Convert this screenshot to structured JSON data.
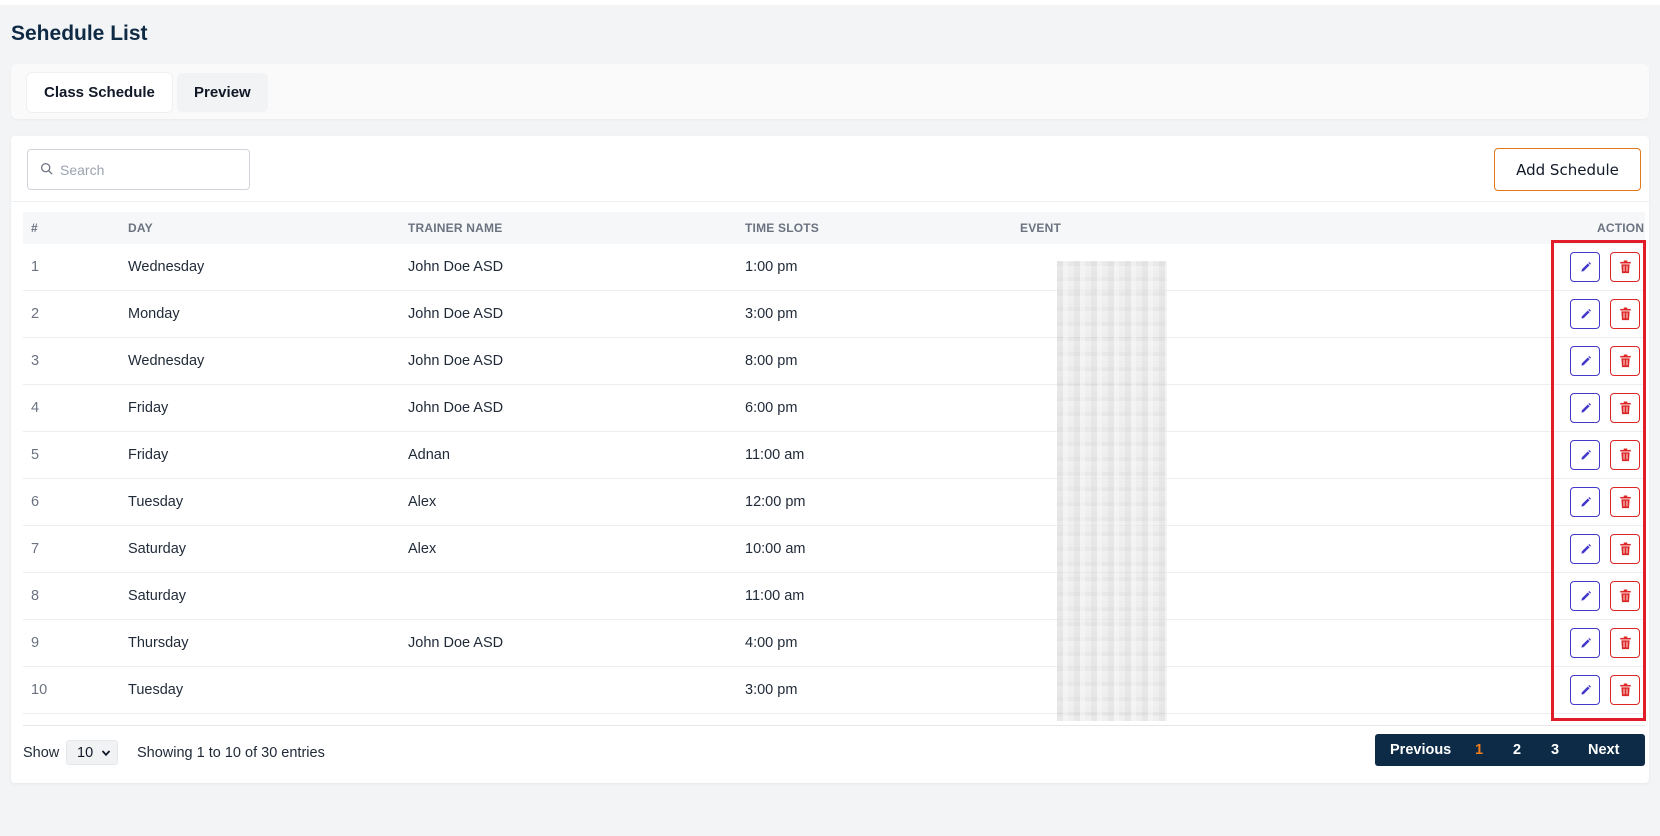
{
  "page": {
    "title": "Sehedule List"
  },
  "tabs": [
    {
      "label": "Class Schedule",
      "active": true
    },
    {
      "label": "Preview",
      "active": false
    }
  ],
  "toolbar": {
    "search_placeholder": "Search",
    "search_value": "",
    "add_button_label": "Add Schedule"
  },
  "table": {
    "columns": {
      "num": "#",
      "day": "DAY",
      "trainer": "TRAINER NAME",
      "time": "TIME SLOTS",
      "event": "EVENT",
      "action": "ACTION"
    },
    "rows": [
      {
        "num": "1",
        "day": "Wednesday",
        "trainer": "John Doe ASD",
        "time": "1:00 pm"
      },
      {
        "num": "2",
        "day": "Monday",
        "trainer": "John Doe ASD",
        "time": "3:00 pm"
      },
      {
        "num": "3",
        "day": "Wednesday",
        "trainer": "John Doe ASD",
        "time": "8:00 pm"
      },
      {
        "num": "4",
        "day": "Friday",
        "trainer": "John Doe ASD",
        "time": "6:00 pm"
      },
      {
        "num": "5",
        "day": "Friday",
        "trainer": "Adnan",
        "time": "11:00 am"
      },
      {
        "num": "6",
        "day": "Tuesday",
        "trainer": "Alex",
        "time": "12:00 pm"
      },
      {
        "num": "7",
        "day": "Saturday",
        "trainer": "Alex",
        "time": "10:00 am"
      },
      {
        "num": "8",
        "day": "Saturday",
        "trainer": "",
        "time": "11:00 am"
      },
      {
        "num": "9",
        "day": "Thursday",
        "trainer": "John Doe ASD",
        "time": "4:00 pm"
      },
      {
        "num": "10",
        "day": "Tuesday",
        "trainer": "",
        "time": "3:00 pm"
      }
    ],
    "row_actions": [
      "pencil-icon",
      "trash-icon"
    ]
  },
  "footer": {
    "show_label": "Show",
    "page_size": "10",
    "entries_text": "Showing 1 to 10 of 30 entries",
    "pagination": {
      "previous": "Previous",
      "pages": [
        "1",
        "2",
        "3"
      ],
      "current": "1",
      "next": "Next"
    }
  },
  "colors": {
    "title": "#0f2a44",
    "accent_orange": "#e0781a",
    "edit": "#4338ca",
    "delete": "#dc2626",
    "pager_bg": "#0d2b46",
    "highlight": "#e11d2a"
  }
}
